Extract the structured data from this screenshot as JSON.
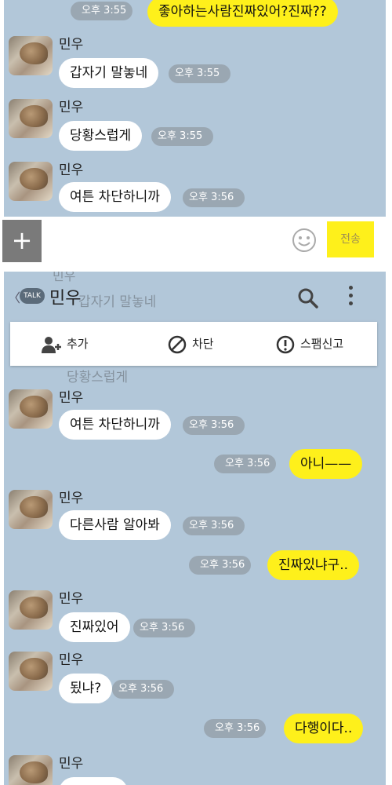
{
  "top": {
    "sent_first": {
      "time": "오후 3:55",
      "text": "좋아하는사람진짜있어?진짜??"
    },
    "messages": [
      {
        "sender": "민우",
        "text": "갑자기 말놓네",
        "time": "오후 3:55"
      },
      {
        "sender": "민우",
        "text": "당황스럽게",
        "time": "오후 3:55"
      },
      {
        "sender": "민우",
        "text": "여튼 차단하니까",
        "time": "오후 3:56"
      }
    ]
  },
  "input_bar": {
    "plus_label": "+",
    "send_label": "전송",
    "emoji_icon": "smiley-icon"
  },
  "header": {
    "back_label": "〈",
    "talk_label": "TALK",
    "title": "민우",
    "ghost_text": "갑자기 말놓네"
  },
  "actions": {
    "add": "추가",
    "block": "차단",
    "report": "스팸신고"
  },
  "bottom": {
    "ghost_text": "당황스럽게",
    "m1": {
      "sender": "민우",
      "text": "여튼 차단하니까",
      "time": "오후 3:56"
    },
    "s1": {
      "text": "아니——",
      "time": "오후 3:56"
    },
    "m2": {
      "sender": "민우",
      "text": "다른사람 알아봐",
      "time": "오후 3:56"
    },
    "s2": {
      "text": "진짜있냐구..",
      "time": "오후 3:56"
    },
    "m3": {
      "sender": "민우",
      "text": "진짜있어",
      "time": "오후 3:56"
    },
    "m4": {
      "sender": "민우",
      "text": "됬냐?",
      "time": "오후 3:56"
    },
    "s3": {
      "text": "다행이다..",
      "time": "오후 3:56"
    },
    "m5": {
      "sender": "민우"
    }
  }
}
